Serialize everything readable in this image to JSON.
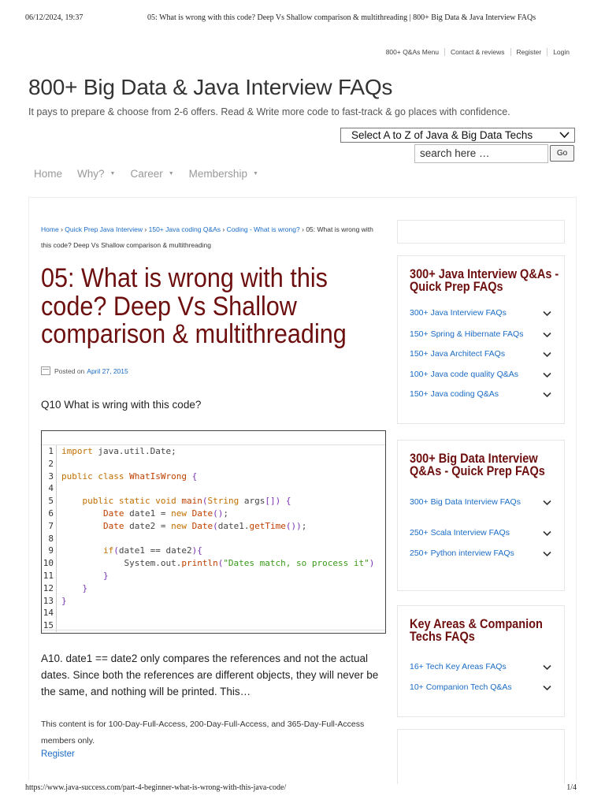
{
  "print": {
    "date": "06/12/2024, 19:37",
    "title": "05: What is wrong with this code? Deep Vs Shallow comparison & multithreading | 800+ Big Data & Java Interview FAQs",
    "url": "https://www.java-success.com/part-4-beginner-what-is-wrong-with-this-java-code/",
    "page": "1/4"
  },
  "topnav": [
    "800+ Q&As Menu",
    "Contact & reviews",
    "Register",
    "Login"
  ],
  "site": {
    "title": "800+ Big Data & Java Interview FAQs",
    "description": "It pays to prepare & choose from 2-6 offers. Read & Write more code to fast-track & go places with confidence."
  },
  "select": {
    "value": "Select A to Z of Java & Big Data Techs"
  },
  "search": {
    "placeholder": "search here …",
    "go_label": "Go"
  },
  "mainnav": [
    {
      "label": "Home",
      "dropdown": false
    },
    {
      "label": "Why?",
      "dropdown": true
    },
    {
      "label": "Career",
      "dropdown": true
    },
    {
      "label": "Membership",
      "dropdown": true
    }
  ],
  "breadcrumb": {
    "items": [
      "Home",
      "Quick Prep Java Interview",
      "150+ Java coding Q&As",
      "Coding - What is wrong?"
    ],
    "separator": "›",
    "current": "05: What is wrong with this code? Deep Vs Shallow comparison & multithreading"
  },
  "post": {
    "title": "05: What is wrong with this code? Deep Vs Shallow comparison & multithreading",
    "posted_label": "Posted on",
    "posted_date": "April 27, 2015",
    "question": "Q10 What is wring with this code?",
    "answer": "A10. date1 == date2 only compares the references and not the actual dates. Since both the references are different objects, they will never be the same, and nothing will be printed. This…",
    "access_note": "This content is for 100-Day-Full-Access, 200-Day-Full-Access, and 365-Day-Full-Access members only.",
    "register_label": "Register"
  },
  "code": {
    "line_numbers": [
      "1",
      "2",
      "3",
      "4",
      "5",
      "6",
      "7",
      "8",
      "9",
      "10",
      "11",
      "12",
      "13",
      "14",
      "15"
    ]
  },
  "widgets": [
    {
      "title": "300+ Java Interview Q&As - Quick Prep FAQs",
      "items": [
        "300+ Java Interview FAQs",
        "150+ Spring & Hibernate FAQs",
        "150+ Java Architect FAQs",
        "100+ Java code quality Q&As",
        "150+ Java coding Q&As"
      ]
    },
    {
      "title": "300+ Big Data Interview Q&As - Quick Prep FAQs",
      "items": [
        "300+ Big Data Interview FAQs",
        "250+ Scala Interview FAQs",
        "250+ Python interview FAQs"
      ]
    },
    {
      "title": "Key Areas & Companion Techs FAQs",
      "items": [
        "16+ Tech Key Areas FAQs",
        "10+ Companion Tech Q&As"
      ]
    }
  ],
  "icons": {
    "chevron": "chevron-down-icon",
    "calendar": "calendar-icon",
    "caret": "caret-down-icon"
  },
  "colors": {
    "title": "#6d0f0f",
    "link": "#1a6bc6",
    "keyword": "#c07000",
    "string": "#3a9a1a"
  }
}
